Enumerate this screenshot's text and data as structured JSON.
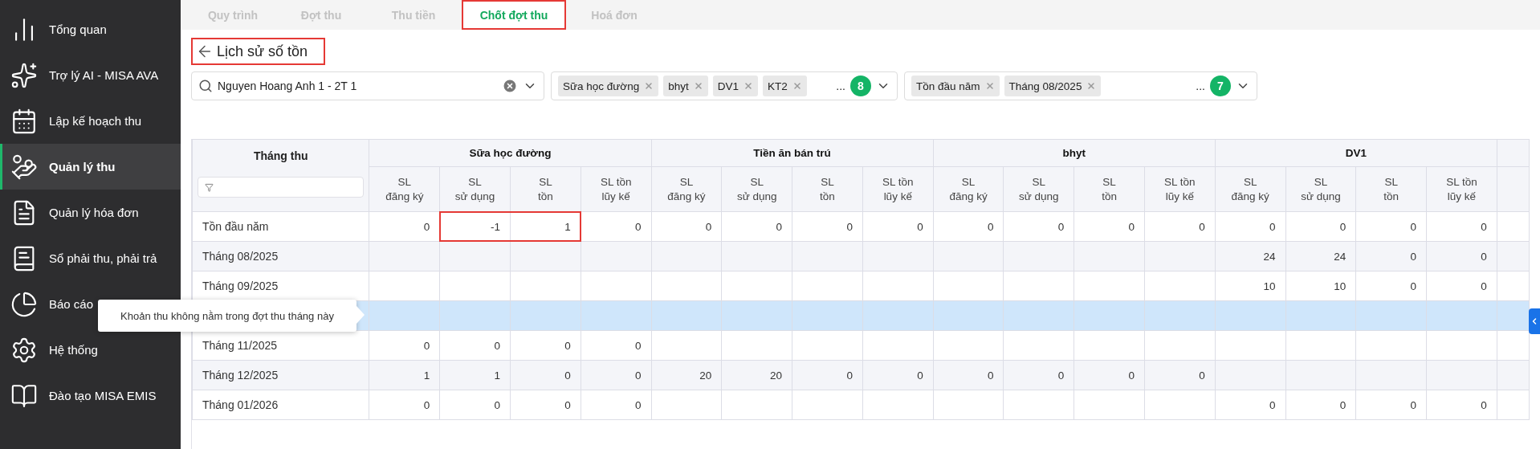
{
  "sidebar": {
    "items": [
      {
        "label": "Tổng quan",
        "selected": false
      },
      {
        "label": "Trợ lý AI - MISA AVA",
        "selected": false
      },
      {
        "label": "Lập kế hoạch thu",
        "selected": false
      },
      {
        "label": "Quản lý thu",
        "selected": true
      },
      {
        "label": "Quản lý hóa đơn",
        "selected": false
      },
      {
        "label": "Sổ phải thu, phải trả",
        "selected": false
      },
      {
        "label": "Báo cáo",
        "selected": false
      },
      {
        "label": "Hệ thống",
        "selected": false
      },
      {
        "label": "Đào tạo MISA EMIS",
        "selected": false
      }
    ]
  },
  "tabs": [
    {
      "label": "Quy trình",
      "selected": false,
      "highlighted": false
    },
    {
      "label": "Đợt thu",
      "selected": false,
      "highlighted": false
    },
    {
      "label": "Thu tiền",
      "selected": false,
      "highlighted": false
    },
    {
      "label": "Chốt đợt thu",
      "selected": true,
      "highlighted": true
    },
    {
      "label": "Hoá đơn",
      "selected": false,
      "highlighted": false
    }
  ],
  "title": {
    "text": "Lịch sử số tồn",
    "highlighted": true
  },
  "filters": {
    "student": {
      "value": "Nguyen Hoang Anh 1 - 2T 1"
    },
    "fees": {
      "tags": [
        "Sữa học đường",
        "bhyt",
        "DV1",
        "KT2"
      ],
      "more": "...",
      "count": "8"
    },
    "periods": {
      "tags": [
        "Tồn đầu năm",
        "Tháng 08/2025"
      ],
      "more": "...",
      "count": "7"
    }
  },
  "table": {
    "month_column": "Tháng thu",
    "groups": [
      {
        "name": "Sữa học đường",
        "columns": [
          "SL\nđăng ký",
          "SL\nsử dụng",
          "SL\ntồn",
          "SL tồn\nlũy kế"
        ]
      },
      {
        "name": "Tiền ăn bán trú",
        "columns": [
          "SL\nđăng ký",
          "SL\nsử dụng",
          "SL\ntồn",
          "SL tồn\nlũy kế"
        ]
      },
      {
        "name": "bhyt",
        "columns": [
          "SL\nđăng ký",
          "SL\nsử dụng",
          "SL\ntồn",
          "SL tồn\nlũy kế"
        ]
      },
      {
        "name": "DV1",
        "columns": [
          "SL\nđăng ký",
          "SL\nsử dụng",
          "SL\ntồn",
          "SL tồn\nlũy kế"
        ]
      }
    ],
    "rows": [
      {
        "month": "Tồn đầu năm",
        "selected": false,
        "sua_hoc_duong": [
          "0",
          "-1",
          "1",
          "0"
        ],
        "tien_an_ban_tru": [
          "0",
          "0",
          "0",
          "0"
        ],
        "bhyt": [
          "0",
          "0",
          "0",
          "0"
        ],
        "dv1": [
          "0",
          "0",
          "0",
          "0"
        ],
        "highlighted_cells": {
          "sua_hoc_duong": [
            false,
            true,
            true,
            false
          ]
        }
      },
      {
        "month": "Tháng 08/2025",
        "selected": false,
        "dv1": [
          "24",
          "24",
          "0",
          "0"
        ]
      },
      {
        "month": "Tháng 09/2025",
        "selected": false,
        "dv1": [
          "10",
          "10",
          "0",
          "0"
        ]
      },
      {
        "selected": true
      },
      {
        "month": "Tháng 11/2025",
        "selected": false,
        "sua_hoc_duong": [
          "0",
          "0",
          "0",
          "0"
        ]
      },
      {
        "month": "Tháng 12/2025",
        "selected": false,
        "sua_hoc_duong": [
          "1",
          "1",
          "0",
          "0"
        ],
        "tien_an_ban_tru": [
          "20",
          "20",
          "0",
          "0"
        ],
        "bhyt": [
          "0",
          "0",
          "0",
          "0"
        ]
      },
      {
        "month": "Tháng 01/2026",
        "selected": false,
        "sua_hoc_duong": [
          "0",
          "0",
          "0",
          "0"
        ],
        "dv1": [
          "0",
          "0",
          "0",
          "0"
        ]
      }
    ]
  },
  "tooltip": {
    "text": "Khoản thu không nằm trong đợt thu tháng này"
  }
}
